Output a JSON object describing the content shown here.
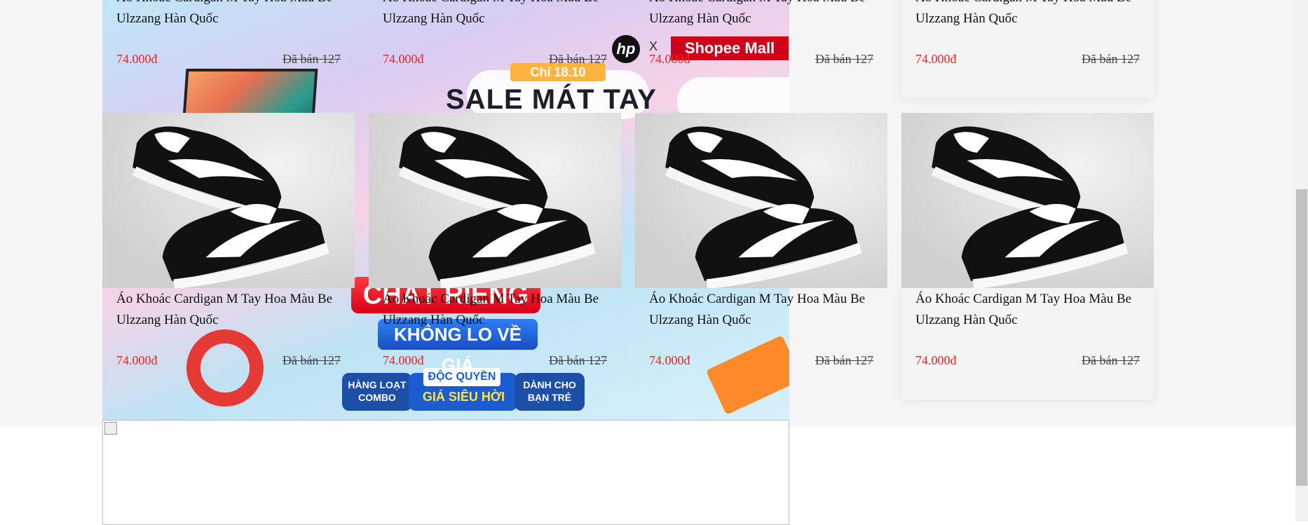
{
  "products": [
    {
      "name": "Áo Khoác Cardigan M Tay Hoa Màu Be Ulzzang Hàn Quốc",
      "price": "74.000đ",
      "sold": "Đã bán 127"
    },
    {
      "name": "Áo Khoác Cardigan M Tay Hoa Màu Be Ulzzang Hàn Quốc",
      "price": "74.000đ",
      "sold": "Đã bán 127"
    },
    {
      "name": "Áo Khoác Cardigan M Tay Hoa Màu Be Ulzzang Hàn Quốc",
      "price": "74.000đ",
      "sold": "Đã bán 127"
    },
    {
      "name": "Áo Khoác Cardigan M Tay Hoa Màu Be Ulzzang Hàn Quốc",
      "price": "74.000đ",
      "sold": "Đã bán 127"
    },
    {
      "name": "Áo Khoác Cardigan M Tay Hoa Màu Be Ulzzang Hàn Quốc",
      "price": "74.000đ",
      "sold": "Đã bán 127"
    },
    {
      "name": "Áo Khoác Cardigan M Tay Hoa Màu Be Ulzzang Hàn Quốc",
      "price": "74.000đ",
      "sold": "Đã bán 127"
    },
    {
      "name": "Áo Khoác Cardigan M Tay Hoa Màu Be Ulzzang Hàn Quốc",
      "price": "74.000đ",
      "sold": "Đã bán 127"
    },
    {
      "name": "Áo Khoác Cardigan M Tay Hoa Màu Be Ulzzang Hàn Quốc",
      "price": "74.000đ",
      "sold": "Đã bán 127"
    }
  ],
  "banner": {
    "brand": "hp",
    "x": "X",
    "mall": "Shopee Mall",
    "chi": "Chỉ 18.10",
    "headline": "SALE MÁT TAY",
    "chat": "CHẤT RIÊNG",
    "khong": "KHÔNG LO VỀ GIÁ",
    "doc_quyen": "ĐỘC QUYỀN",
    "gia": "GIÁ SIÊU HỜI",
    "left_pill": "HÀNG LOẠT COMBO",
    "right_pill": "DÀNH CHO BẠN TRẺ"
  },
  "colors": {
    "price": "#ee2424",
    "shopee_mall": "#d0011b"
  }
}
